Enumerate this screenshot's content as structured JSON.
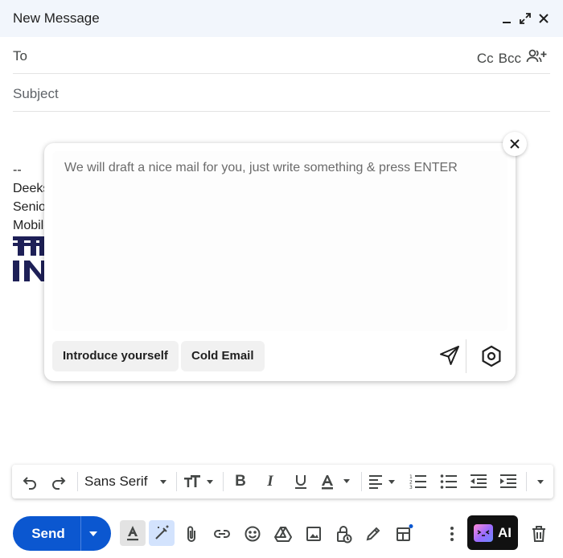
{
  "window": {
    "title": "New Message",
    "controls": [
      "minimize-icon",
      "expand-icon",
      "close-icon"
    ]
  },
  "fields": {
    "to_label": "To",
    "cc_label": "Cc",
    "bcc_label": "Bcc",
    "subject_placeholder": "Subject"
  },
  "signature": {
    "separator": "--",
    "line1": "Deeks",
    "line2": "Senio",
    "line3": "Mobile"
  },
  "ai_panel": {
    "placeholder": "We will draft a nice mail for you, just write something & press ENTER",
    "chips": [
      "Introduce yourself",
      "Cold Email"
    ],
    "icons": [
      "close-icon",
      "send-icon",
      "settings-icon"
    ]
  },
  "format_toolbar": {
    "font_family": "Sans Serif",
    "tools": [
      "undo-icon",
      "redo-icon",
      "font-size-icon",
      "bold-icon",
      "italic-icon",
      "underline-icon",
      "text-color-icon",
      "align-icon",
      "numbered-list-icon",
      "bulleted-list-icon",
      "indent-less-icon",
      "indent-more-icon",
      "more-formatting-icon"
    ]
  },
  "bottom_toolbar": {
    "send_label": "Send",
    "ai_label": "AI",
    "tools": [
      "formatting-options-icon",
      "magic-pen-icon",
      "attach-icon",
      "link-icon",
      "emoji-icon",
      "drive-icon",
      "photo-icon",
      "confidential-icon",
      "signature-icon",
      "template-icon",
      "more-options-icon",
      "trash-icon"
    ]
  },
  "colors": {
    "header_bg": "#f2f6fc",
    "send_blue": "#0b57d0",
    "ai_button_bg": "#111111",
    "notification_dot": "#0b57d0"
  }
}
